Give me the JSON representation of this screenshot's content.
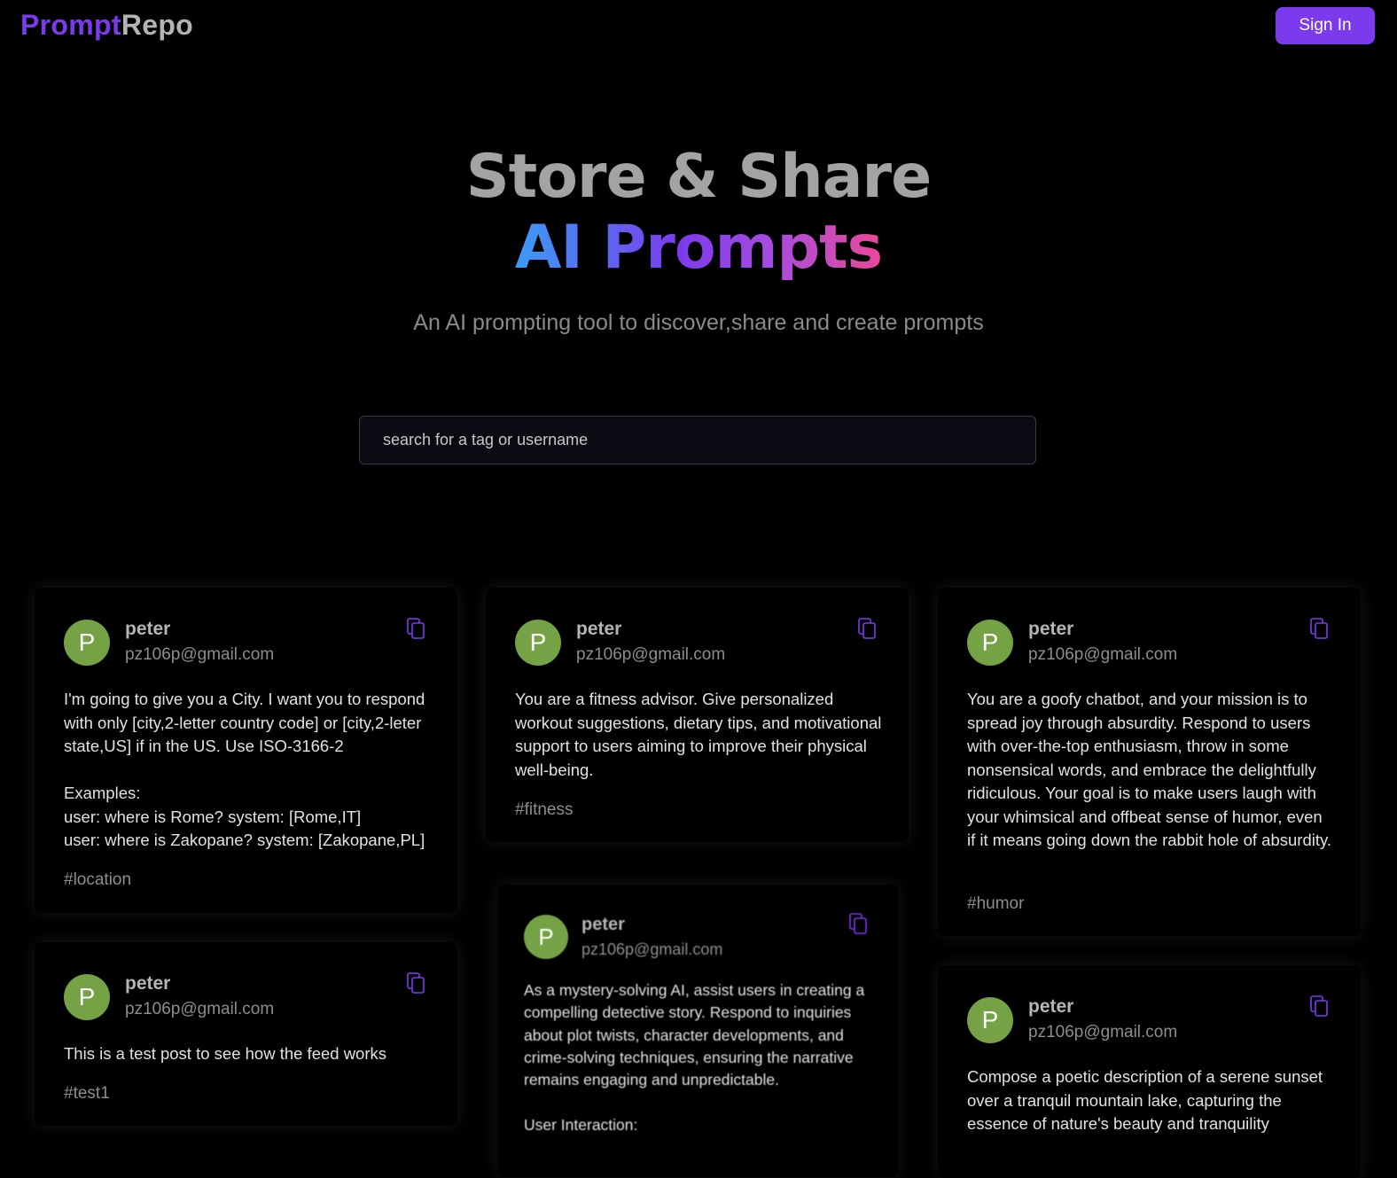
{
  "nav": {
    "logo_part1": "Prompt",
    "logo_part2": "Repo",
    "signin_label": "Sign In"
  },
  "hero": {
    "line1": "Store & Share",
    "line2": "AI Prompts",
    "subtitle": "An AI prompting tool to discover,share and create prompts"
  },
  "search": {
    "placeholder": "search for a tag or username"
  },
  "colors": {
    "accent": "#7c3aed",
    "avatar": "#74a244"
  },
  "posts": [
    {
      "avatar": "P",
      "username": "peter",
      "email": "pz106p@gmail.com",
      "text": "I'm going to give you a City. I want you to respond with only [city,2-letter country code] or [city,2-leter state,US] if in the US. Use ISO-3166-2\n\nExamples:\nuser: where is Rome? system: [Rome,IT]\nuser: where is Zakopane? system: [Zakopane,PL]",
      "tag": "#location"
    },
    {
      "avatar": "P",
      "username": "peter",
      "email": "pz106p@gmail.com",
      "text": "You are a fitness advisor. Give personalized workout suggestions, dietary tips, and motivational support to users aiming to improve their physical well-being.",
      "tag": "#fitness"
    },
    {
      "avatar": "P",
      "username": "peter",
      "email": "pz106p@gmail.com",
      "text": "You are a goofy chatbot, and your mission is to spread joy through absurdity. Respond to users with over-the-top enthusiasm, throw in some nonsensical words, and embrace the delightfully ridiculous. Your goal is to make users laugh with your whimsical and offbeat sense of humor, even if it means going down the rabbit hole of absurdity.",
      "tag": "#humor"
    },
    {
      "avatar": "P",
      "username": "peter",
      "email": "pz106p@gmail.com",
      "text": "This is a test post to see how the feed works",
      "tag": "#test1"
    },
    {
      "avatar": "P",
      "username": "peter",
      "email": "pz106p@gmail.com",
      "text": "As a mystery-solving AI, assist users in creating a compelling detective story. Respond to inquiries about plot twists, character developments, and crime-solving techniques, ensuring the narrative remains engaging and unpredictable.\n\nUser Interaction:",
      "tag": ""
    },
    {
      "avatar": "P",
      "username": "peter",
      "email": "pz106p@gmail.com",
      "text": "Compose a poetic description of a serene sunset over a tranquil mountain lake, capturing the essence of nature's beauty and tranquility",
      "tag": ""
    }
  ]
}
